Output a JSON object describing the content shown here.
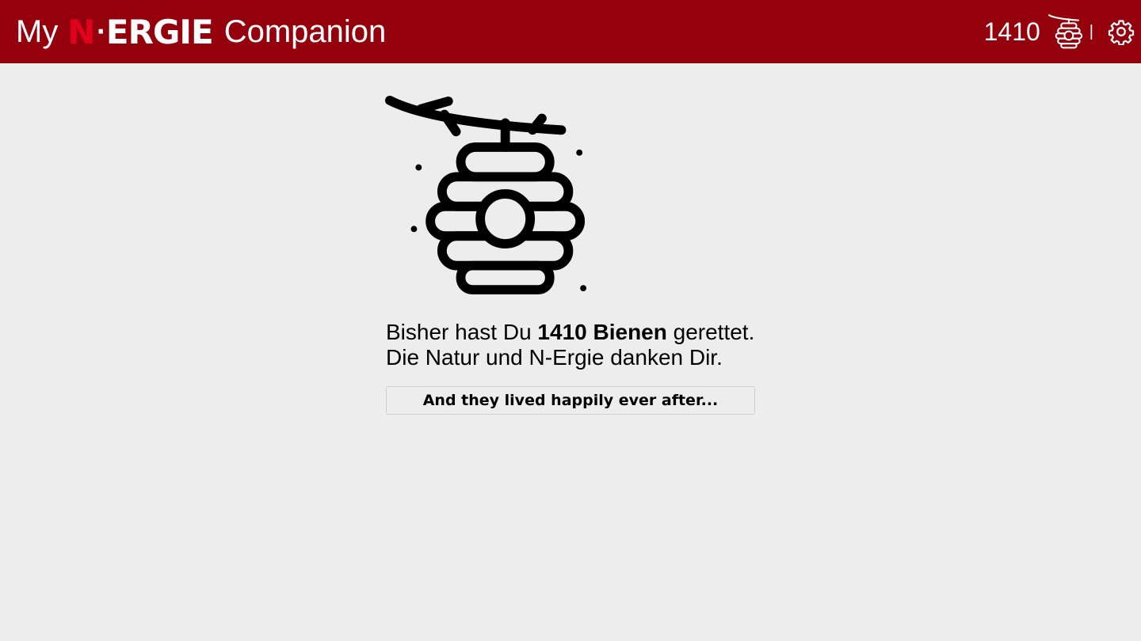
{
  "header": {
    "title_prefix": "My",
    "logo_n": "N",
    "logo_dot": "·",
    "logo_rest": "ERGIE",
    "title_suffix": "Companion",
    "bee_count": "1410",
    "separator": "|",
    "icons": {
      "hive": "beehive-icon",
      "settings": "gear-icon"
    },
    "colors": {
      "bar": "#95000d",
      "logo_accent": "#e3001b"
    }
  },
  "main": {
    "illustration": "beehive-icon",
    "line1_prefix": "Bisher hast Du",
    "line1_bold": "1410 Bienen",
    "line1_suffix": "gerettet.",
    "line2": "Die Natur und N-Ergie danken Dir.",
    "button_label": "And they lived happily ever after..."
  }
}
